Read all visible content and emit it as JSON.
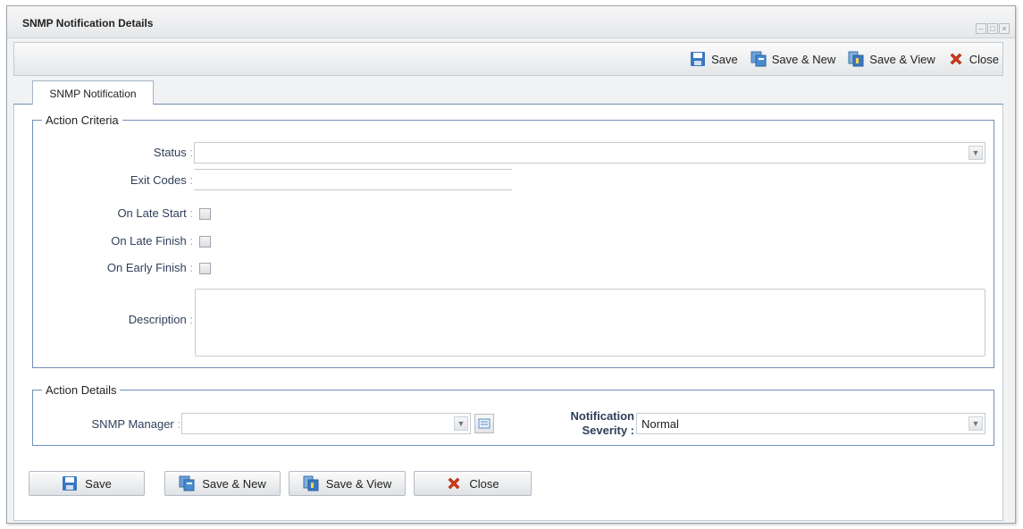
{
  "window": {
    "title": "SNMP Notification Details"
  },
  "toolbar": {
    "save": "Save",
    "save_new": "Save & New",
    "save_view": "Save & View",
    "close": "Close"
  },
  "tabs": [
    {
      "label": "SNMP Notification",
      "selected": true
    }
  ],
  "action_criteria": {
    "legend": "Action Criteria",
    "status_label": "Status",
    "status_value": "",
    "exit_codes_label": "Exit Codes",
    "exit_codes_value": "",
    "on_late_start_label": "On Late Start",
    "on_late_start_checked": false,
    "on_late_finish_label": "On Late Finish",
    "on_late_finish_checked": false,
    "on_early_finish_label": "On Early Finish",
    "on_early_finish_checked": false,
    "description_label": "Description",
    "description_value": ""
  },
  "action_details": {
    "legend": "Action Details",
    "snmp_manager_label": "SNMP Manager",
    "snmp_manager_value": "",
    "severity_label_line1": "Notification",
    "severity_label_line2": "Severity :",
    "severity_value": "Normal"
  },
  "bottom_buttons": {
    "save": "Save",
    "save_new": "Save & New",
    "save_view": "Save & View",
    "close": "Close"
  },
  "icons": {
    "save": "floppy-disk-icon",
    "save_new": "copy-icon",
    "save_view": "document-view-icon",
    "close": "red-x-icon"
  },
  "colors": {
    "fieldset_border": "#6f8fb5",
    "label_text": "#2f3f5a",
    "save_icon": "#3a78c2",
    "close_icon": "#d23a1a"
  }
}
